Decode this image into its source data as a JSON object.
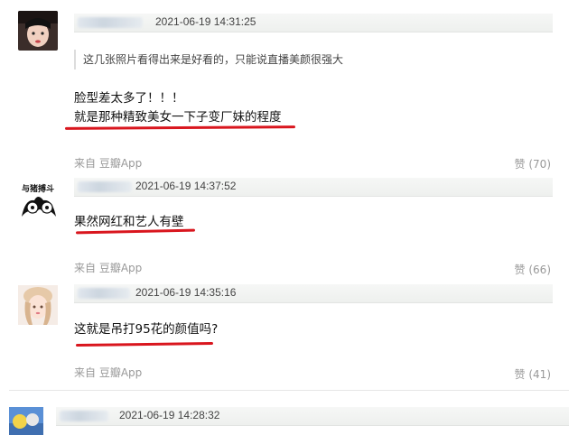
{
  "comments": [
    {
      "timestamp": "2021-06-19 14:31:25",
      "quote": "这几张照片看得出来是好看的，只能说直播美颜很强大",
      "lines": [
        "脸型差太多了！！！",
        "就是那种精致美女一下子变厂妹的程度"
      ],
      "source": "来自 豆瓣App",
      "likes": "赞 (70)"
    },
    {
      "avatar_caption": "与猪搏斗",
      "timestamp": "2021-06-19 14:37:52",
      "lines": [
        "果然网红和艺人有壁"
      ],
      "source": "来自 豆瓣App",
      "likes": "赞 (66)"
    },
    {
      "timestamp": "2021-06-19 14:35:16",
      "lines": [
        "这就是吊打95花的颜值吗?"
      ],
      "source": "来自 豆瓣App",
      "likes": "赞 (41)"
    },
    {
      "timestamp": "2021-06-19 14:28:32"
    }
  ],
  "colors": {
    "underline": "#d9161e",
    "muted": "#999999"
  }
}
